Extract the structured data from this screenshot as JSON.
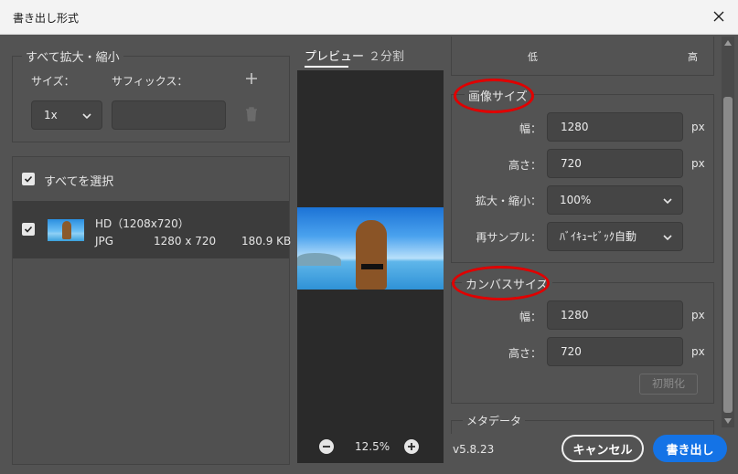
{
  "window": {
    "title": "書き出し形式"
  },
  "left": {
    "scale_header": "すべて拡大・縮小",
    "size_label": "サイズ：",
    "suffix_label": "サフィックス：",
    "size_value": "1x",
    "suffix_value": "",
    "select_all_label": "すべてを選択",
    "assets": [
      {
        "name": "HD（1208x720）",
        "format": "JPG",
        "dimensions": "1280 x 720",
        "filesize": "180.9 KB"
      }
    ]
  },
  "preview": {
    "tabs": [
      {
        "label": "プレビュー",
        "active": true
      },
      {
        "label": "２分割",
        "active": false
      }
    ],
    "zoom": "12.5%"
  },
  "right": {
    "quality_low": "低",
    "quality_high": "高",
    "image_size": {
      "header": "画像サイズ",
      "width_label": "幅：",
      "width_value": "1280",
      "height_label": "高さ：",
      "height_value": "720",
      "scale_label": "拡大・縮小：",
      "scale_value": "100%",
      "resample_label": "再サンプル：",
      "resample_value": "ﾊﾞｲｷｭｰﾋﾞｯｸ自動",
      "unit": "px"
    },
    "canvas_size": {
      "header": "カンバスサイズ",
      "width_label": "幅：",
      "width_value": "1280",
      "height_label": "高さ：",
      "height_value": "720",
      "unit": "px",
      "reset_label": "初期化"
    },
    "metadata_header": "メタデータ"
  },
  "footer": {
    "version": "v5.8.23",
    "cancel_label": "キャンセル",
    "export_label": "書き出し"
  },
  "colors": {
    "annotation": "#e00000",
    "primary": "#1473e6",
    "background": "#535353"
  }
}
